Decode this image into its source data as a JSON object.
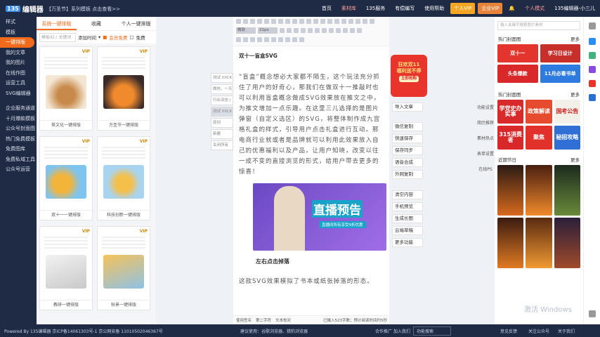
{
  "topbar": {
    "logo_mark": "135",
    "logo_text": "编辑器",
    "promo": "【万圣节】系列模板 点击查看>>",
    "nav": [
      "首页",
      "素材库",
      "135服务",
      "有偿编写",
      "使用帮助"
    ],
    "vip_personal": "个人VIP",
    "vip_company": "企业VIP",
    "personal_mode": "个人模式",
    "user": "135编辑器-小三儿"
  },
  "sidebar": {
    "items_top": [
      "样式",
      "模板",
      "一键排版",
      "我的文章",
      "我的图片",
      "在线作图",
      "运营工具",
      "SVG编辑器"
    ],
    "active_index": 2,
    "items_bottom": [
      "企业服务通道",
      "十月爆款模板",
      "公众号封面图",
      "热门免费模板",
      "免费图库",
      "免费私域工具",
      "公众号运营"
    ]
  },
  "templates": {
    "tabs": [
      "系统一键排版",
      "收藏",
      "个人一键排版"
    ],
    "search_placeholder": "模板ID / 关键词",
    "sort": "添加时间",
    "filter_vip": "会员免费",
    "filter_free": "免费",
    "cards": [
      {
        "caption": "茶文化一键排版",
        "vip": "VIP"
      },
      {
        "caption": "万圣节一键排版",
        "vip": "VIP"
      },
      {
        "caption": "双十一一键排版",
        "vip": "VIP"
      },
      {
        "caption": "科技创新一键排版",
        "vip": "VIP"
      },
      {
        "caption": "教研一键排版",
        "vip": "VIP"
      },
      {
        "caption": "秋景一键排版",
        "vip": "VIP"
      }
    ]
  },
  "controls": {
    "fields": [
      "测试 0XCK",
      "微信，一天",
      "行业动态 |",
      "测试 0XCK",
      "原创",
      "新建",
      "关闭所有"
    ]
  },
  "editor": {
    "font_select": "微软",
    "size_select": "21px",
    "title": "双十一盲盒SVG",
    "paragraph1": "“盲盒”概念想必大家都不陌生，这个玩法充分抓住了用户的好奇心，那我们在做双十一推敲时也可以利用盲盒概念做成SVG效果放在推文之中，为推文增加一点乐趣。在这里三儿选择的是图片弹窗（自定义选区）的SVG，将整体制作成九宫格礼盒的样式，引导用户点击礼盒进行互动。那电商行业就或者是品牌就可以利用此效果放入自己的优惠福利以及产品，让用户知晓，改变以往一成不变的直接浏览的形式，给用户带去更多的惊喜！",
    "banner_title": "直播预告",
    "banner_sub": "直播间所有享受9折优惠",
    "caption": "左右点击掉落",
    "paragraph2": "这款SVG效果模拟了书本或纸张掉落的形态。",
    "footer": [
      "使用签名",
      "第二字符",
      "文本校对"
    ],
    "word_count": "已输入523字数；预计阅读时间约5秒"
  },
  "tools": [
    "导入文章",
    "微信复制",
    "快速保存",
    "保存同步",
    "语音合成",
    "外网复制",
    "清空内容",
    "手机预览",
    "生成长图",
    "云端草稿",
    "更多功能"
  ],
  "red_promo": {
    "line1": "狂欢双11",
    "line2": "福利送不停",
    "button": "立即抢购"
  },
  "right_panel": {
    "search_placeholder": "输入关键字搜索图片素材",
    "section1": "热门封面图",
    "section2": "热门封面图",
    "section3": "近期节日",
    "more": "更多",
    "thumbs1": [
      "双十一",
      "学习日设计",
      "头条爆款",
      "11月必看书单"
    ],
    "thumbs2": [
      "学党史办实事",
      "政策解读",
      "国考公告",
      "315消费者",
      "聚焦",
      "秘招攻略"
    ],
    "side_labels": [
      "功能设置",
      "简历推荐",
      "素材热点",
      "表单设置",
      "在线PS"
    ]
  },
  "status": {
    "left": "Powered By 135编辑器 京ICP备14061303号-1 京公网安备 11010502046367号",
    "mid": "建议使用：谷歌浏览器、猎豹浏览器",
    "links": [
      "合作推广",
      "加入我们"
    ],
    "search_placeholder": "功能搜索",
    "right": [
      "意见反馈",
      "关注公众号",
      "关于我们"
    ],
    "watermark": "激活 Windows"
  },
  "colors": {
    "accent": "#f26b1d",
    "dark": "#1f2a44",
    "vip": "#f5a623",
    "promo_red": "#e8342a"
  }
}
